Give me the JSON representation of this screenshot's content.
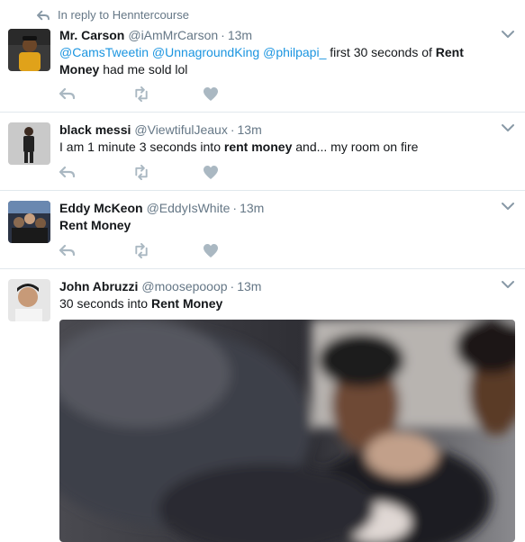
{
  "reply_context": {
    "text": "In reply to Henntercourse"
  },
  "tweets": [
    {
      "name": "Mr. Carson",
      "handle": "@iAmMrCarson",
      "time": "13m",
      "mentions": [
        "@CamsTweetin",
        "@UnnagroundKing",
        "@philpapi_"
      ],
      "text_plain": "first 30 seconds of",
      "text_bold": "Rent Money",
      "text_after": "had me sold lol"
    },
    {
      "name": "black messi",
      "handle": "@ViewtifulJeaux",
      "time": "13m",
      "text_plain": "I am 1 minute 3 seconds into",
      "text_bold": "rent money",
      "text_after": "and... my room on fire"
    },
    {
      "name": "Eddy McKeon",
      "handle": "@EddyIsWhite",
      "time": "13m",
      "text_bold": "Rent Money"
    },
    {
      "name": "John Abruzzi",
      "handle": "@moosepooop",
      "time": "13m",
      "text_plain": "30 seconds into",
      "text_bold": "Rent Money"
    }
  ],
  "colors": {
    "secondary": "#657786",
    "link": "#1b95e0",
    "action_icon": "#aab8c2",
    "divider": "#e1e8ed"
  },
  "icons": [
    "reply-icon",
    "retweet-icon",
    "like-icon",
    "chevron-down-icon"
  ]
}
